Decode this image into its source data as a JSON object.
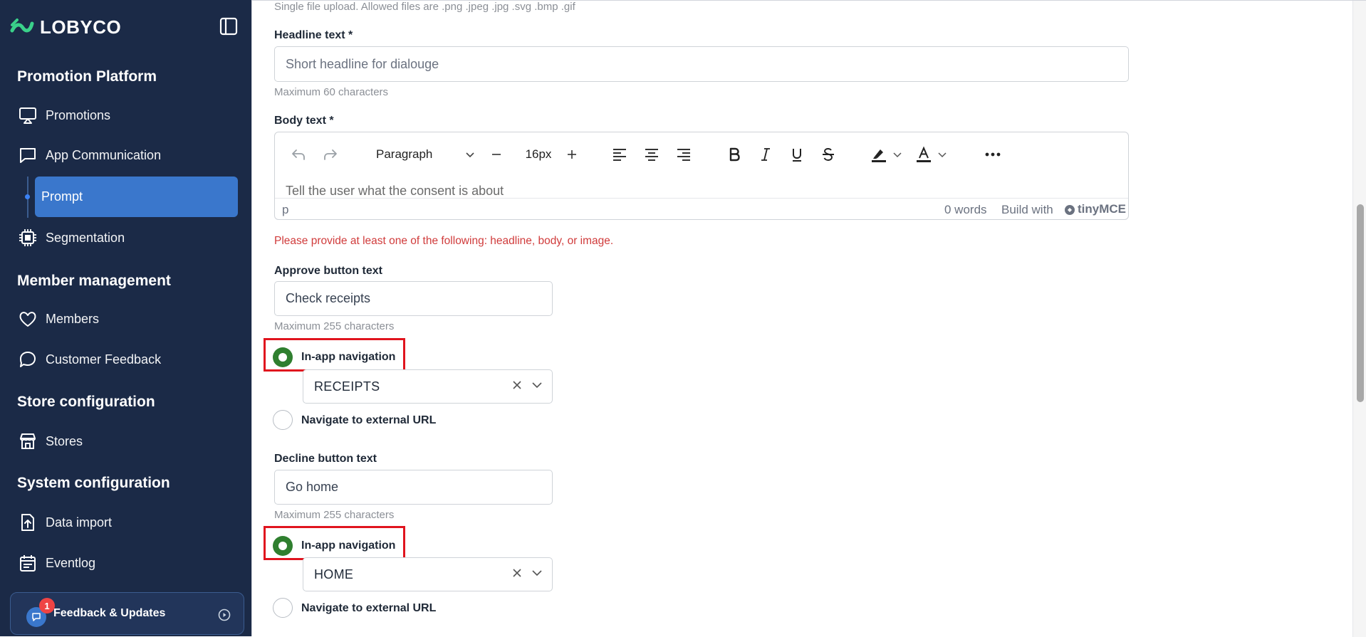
{
  "sidebar": {
    "brand": "LOBYCO",
    "sections": [
      {
        "title": "Promotion Platform"
      },
      {
        "title": "Member management"
      },
      {
        "title": "Store configuration"
      },
      {
        "title": "System configuration"
      }
    ],
    "items": {
      "promotions": "Promotions",
      "app_communication": "App Communication",
      "prompt": "Prompt",
      "segmentation": "Segmentation",
      "members": "Members",
      "customer_feedback": "Customer Feedback",
      "stores": "Stores",
      "data_import": "Data import",
      "eventlog": "Eventlog"
    },
    "feedback": {
      "label": "Feedback & Updates",
      "badge": "1"
    }
  },
  "form": {
    "upload_hint": "Single file upload. Allowed files are .png .jpeg .jpg .svg .bmp .gif",
    "headline": {
      "label": "Headline text *",
      "placeholder": "Short headline for dialouge",
      "hint": "Maximum 60 characters"
    },
    "body": {
      "label": "Body text *",
      "toolbar": {
        "block_format": "Paragraph",
        "font_size": "16px"
      },
      "placeholder": "Tell the user what the consent is about",
      "path": "p",
      "word_count": "0 words",
      "built_with": "Build with",
      "tinymce": "tinyMCE"
    },
    "error": "Please provide at least one of the following: headline, body, or image.",
    "approve": {
      "label": "Approve button text",
      "value": "Check receipts",
      "hint": "Maximum 255 characters",
      "option_inapp": "In-app navigation",
      "selected_target": "RECEIPTS",
      "option_external": "Navigate to external URL"
    },
    "decline": {
      "label": "Decline button text",
      "value": "Go home",
      "hint": "Maximum 255 characters",
      "option_inapp": "In-app navigation",
      "selected_target": "HOME",
      "option_external": "Navigate to external URL"
    }
  },
  "colors": {
    "sidebar_bg": "#1b2a47",
    "active_item": "#3a77cc",
    "radio_selected": "#2f7f2f",
    "error_text": "#d03b3b",
    "highlight_box": "#e0141e"
  }
}
